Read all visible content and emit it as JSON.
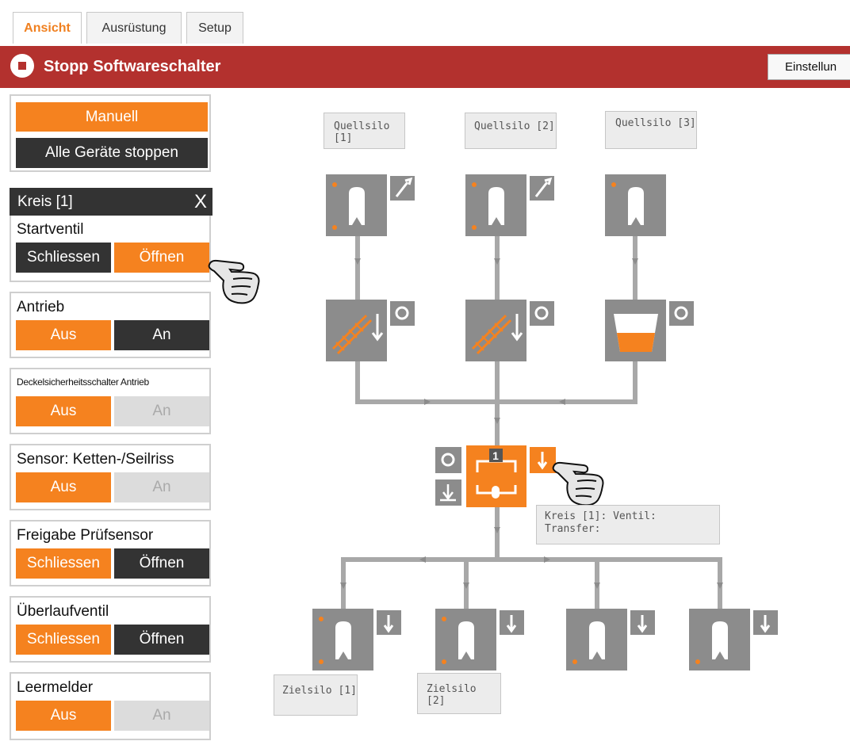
{
  "tabs": [
    "Ansicht",
    "Ausrüstung",
    "Setup"
  ],
  "header": {
    "title": "Stopp Softwareschalter",
    "settings_label": "Einstellun"
  },
  "controls": {
    "mode": "Manuell",
    "stop_all": "Alle Geräte stoppen"
  },
  "circuit": {
    "title": "Kreis [1]",
    "close": "X"
  },
  "panels": [
    {
      "label": "Startventil",
      "left": "Schliessen",
      "right": "Öffnen",
      "active": "right"
    },
    {
      "label": "Antrieb",
      "left": "Aus",
      "right": "An",
      "active": "left"
    },
    {
      "label": "Deckelsicherheitsschalter Antrieb",
      "left": "Aus",
      "right": "An",
      "active": "left"
    },
    {
      "label": "Sensor: Ketten-/Seilriss",
      "left": "Aus",
      "right": "An",
      "active": "left"
    },
    {
      "label": "Freigabe Prüfsensor",
      "left": "Schliessen",
      "right": "Öffnen",
      "active": "left"
    },
    {
      "label": "Überlaufventil",
      "left": "Schliessen",
      "right": "Öffnen",
      "active": "left"
    },
    {
      "label": "Leermelder",
      "left": "Aus",
      "right": "An",
      "active": "left"
    }
  ],
  "diagram": {
    "sources": [
      "Quellsilo [1]",
      "Quellsilo [2]",
      "Quellsilo [3]"
    ],
    "targets": [
      "Zielsilo [1]",
      "Zielsilo [2]"
    ],
    "valve_number": "1",
    "info_line1": "Kreis [1]: Ventil:",
    "info_line2": "Transfer:"
  },
  "colors": {
    "accent": "#f5821f",
    "header_red": "#b3312e",
    "dark": "#333333",
    "device_gray": "#8c8c8c",
    "pipe": "#a8a8a8"
  }
}
